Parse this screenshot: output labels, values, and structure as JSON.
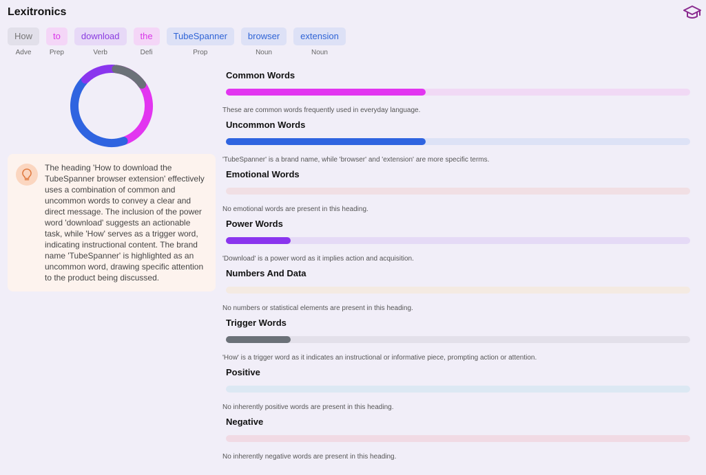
{
  "app": {
    "title": "Lexitronics",
    "icon": "graduation-cap-icon"
  },
  "tokens": [
    {
      "word": "How",
      "pos": "Adve",
      "bg": "#e2e0ea",
      "fg": "#777777"
    },
    {
      "word": "to",
      "pos": "Prep",
      "bg": "#f4d6f7",
      "fg": "#d936e8"
    },
    {
      "word": "download",
      "pos": "Verb",
      "bg": "#e7d9f7",
      "fg": "#8a3ce0"
    },
    {
      "word": "the",
      "pos": "Defi",
      "bg": "#f4d6f7",
      "fg": "#d936e8"
    },
    {
      "word": "TubeSpanner",
      "pos": "Prop",
      "bg": "#dde1f6",
      "fg": "#2f64d6"
    },
    {
      "word": "browser",
      "pos": "Noun",
      "bg": "#dde1f6",
      "fg": "#2f64d6"
    },
    {
      "word": "extension",
      "pos": "Noun",
      "bg": "#dde1f6",
      "fg": "#2f64d6"
    }
  ],
  "donut": {
    "segments": [
      {
        "color": "#e235f0",
        "fraction": 0.4286
      },
      {
        "color": "#2f64e0",
        "fraction": 0.4286
      },
      {
        "color": "#8a35ee",
        "fraction": 0.1428
      },
      {
        "color": "#6b7178",
        "fraction": 0.1428
      }
    ]
  },
  "insight": {
    "icon": "lightbulb-icon",
    "text": "The heading 'How to download the TubeSpanner browser extension' effectively uses a combination of common and uncommon words to convey a clear and direct message. The inclusion of the power word 'download' suggests an actionable task, while 'How' serves as a trigger word, indicating instructional content. The brand name 'TubeSpanner' is highlighted as an uncommon word, drawing specific attention to the product being discussed."
  },
  "metrics": [
    {
      "title": "Common Words",
      "value": 0.43,
      "color": "#e235f0",
      "track": "#f1d9f5",
      "desc": "These are common words frequently used in everyday language."
    },
    {
      "title": "Uncommon Words",
      "value": 0.43,
      "color": "#2f64e0",
      "track": "#dde2f6",
      "desc": "'TubeSpanner' is a brand name, while 'browser' and 'extension' are more specific terms."
    },
    {
      "title": "Emotional Words",
      "value": 0,
      "color": "#e04040",
      "track": "#f1dfe4",
      "desc": "No emotional words are present in this heading."
    },
    {
      "title": "Power Words",
      "value": 0.14,
      "color": "#8a35ee",
      "track": "#e5daf6",
      "desc": "'Download' is a power word as it implies action and acquisition."
    },
    {
      "title": "Numbers And Data",
      "value": 0,
      "color": "#e0a040",
      "track": "#f4eae2",
      "desc": "No numbers or statistical elements are present in this heading."
    },
    {
      "title": "Trigger Words",
      "value": 0.14,
      "color": "#6b7178",
      "track": "#e3e0ea",
      "desc": "'How' is a trigger word as it indicates an instructional or informative piece, prompting action or attention."
    },
    {
      "title": "Positive",
      "value": 0,
      "color": "#30a0e0",
      "track": "#dce8f3",
      "desc": "No inherently positive words are present in this heading."
    },
    {
      "title": "Negative",
      "value": 0,
      "color": "#e04070",
      "track": "#f1dae4",
      "desc": "No inherently negative words are present in this heading."
    }
  ]
}
